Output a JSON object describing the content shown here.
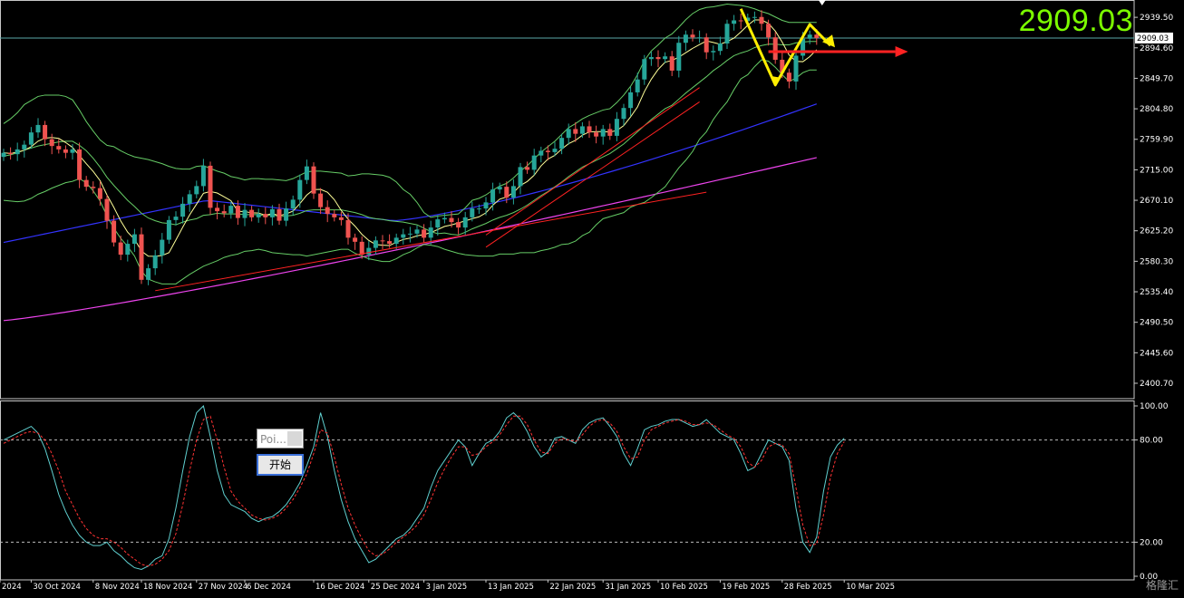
{
  "current_price_display": "2909.03",
  "watermark_text": "格隆汇",
  "widget": {
    "field_text": "Poi...",
    "button_label": "开始"
  },
  "colors": {
    "bull": "#26a69a",
    "bear": "#ef5350",
    "ma_fast": "#ffff99",
    "ma_mid": "#3333ff",
    "ma_slow": "#ee44ee",
    "bollinger": "#66cc66",
    "trend": "#ff2222",
    "pattern": "#ffee00",
    "stoch_main": "#5fd0d0",
    "stoch_signal": "#ff3333",
    "big_price": "#7CFC00"
  },
  "chart_data": [
    {
      "type": "candlestick",
      "title": "",
      "x_labels": [
        "2024",
        "30 Oct 2024",
        "8 Nov 2024",
        "18 Nov 2024",
        "27 Nov 2024",
        "6 Dec 2024",
        "16 Dec 2024",
        "25 Dec 2024",
        "3 Jan 2025",
        "13 Jan 2025",
        "22 Jan 2025",
        "31 Jan 2025",
        "10 Feb 2025",
        "19 Feb 2025",
        "28 Feb 2025",
        "10 Mar 2025"
      ],
      "y_ticks": [
        2939.5,
        2894.6,
        2849.7,
        2804.8,
        2759.9,
        2715.0,
        2670.1,
        2625.2,
        2580.3,
        2535.4,
        2490.5,
        2445.6,
        2400.7
      ],
      "ylim": [
        2378,
        2965
      ],
      "price_line": 2909.03,
      "price_label": "2909.03",
      "close": [
        2740,
        2738,
        2745,
        2752,
        2770,
        2781,
        2760,
        2750,
        2745,
        2740,
        2745,
        2700,
        2690,
        2688,
        2672,
        2640,
        2608,
        2590,
        2606,
        2620,
        2553,
        2570,
        2589,
        2612,
        2641,
        2646,
        2665,
        2679,
        2691,
        2721,
        2659,
        2654,
        2651,
        2662,
        2644,
        2656,
        2645,
        2650,
        2645,
        2657,
        2640,
        2658,
        2671,
        2700,
        2720,
        2680,
        2660,
        2650,
        2645,
        2641,
        2615,
        2609,
        2590,
        2600,
        2611,
        2610,
        2606,
        2615,
        2620,
        2621,
        2627,
        2615,
        2630,
        2642,
        2644,
        2638,
        2630,
        2645,
        2658,
        2658,
        2667,
        2686,
        2690,
        2674,
        2691,
        2719,
        2715,
        2736,
        2743,
        2741,
        2746,
        2762,
        2775,
        2768,
        2779,
        2770,
        2764,
        2775,
        2765,
        2790,
        2806,
        2829,
        2848,
        2878,
        2881,
        2878,
        2882,
        2861,
        2902,
        2914,
        2910,
        2910,
        2888,
        2890,
        2901,
        2930,
        2935,
        2934,
        2939,
        2940,
        2930,
        2910,
        2877,
        2858,
        2845,
        2883,
        2908,
        2914,
        2909
      ],
      "bollinger_upper": [
        2783,
        2790,
        2799,
        2811,
        2817,
        2823,
        2825,
        2825,
        2825,
        2823,
        2818,
        2803,
        2786,
        2772,
        2759,
        2751,
        2749,
        2743,
        2738,
        2734,
        2732,
        2730,
        2727,
        2724,
        2720,
        2717,
        2716,
        2716,
        2720,
        2721,
        2717,
        2713,
        2710,
        2705,
        2703,
        2700,
        2702,
        2702,
        2701,
        2701,
        2700,
        2699,
        2702,
        2707,
        2712,
        2713,
        2713,
        2712,
        2711,
        2710,
        2706,
        2707,
        2709,
        2709,
        2708,
        2707,
        2704,
        2697,
        2686,
        2679,
        2667,
        2652,
        2645,
        2647,
        2648,
        2649,
        2650,
        2659,
        2670,
        2673,
        2678,
        2685,
        2691,
        2695,
        2703,
        2713,
        2721,
        2731,
        2741,
        2749,
        2757,
        2767,
        2777,
        2783,
        2790,
        2795,
        2799,
        2803,
        2805,
        2814,
        2825,
        2838,
        2855,
        2876,
        2890,
        2899,
        2909,
        2915,
        2925,
        2936,
        2945,
        2951,
        2954,
        2955,
        2957,
        2959,
        2958,
        2957,
        2955,
        2952,
        2948,
        2945,
        2940,
        2935,
        2932,
        2932,
        2932,
        2932,
        2932
      ],
      "bollinger_lower": [
        2670,
        2669,
        2668,
        2669,
        2673,
        2679,
        2683,
        2688,
        2692,
        2696,
        2698,
        2702,
        2696,
        2684,
        2669,
        2647,
        2629,
        2614,
        2602,
        2588,
        2566,
        2554,
        2550,
        2547,
        2547,
        2547,
        2554,
        2561,
        2567,
        2573,
        2577,
        2581,
        2586,
        2589,
        2591,
        2595,
        2596,
        2598,
        2596,
        2593,
        2592,
        2591,
        2590,
        2590,
        2588,
        2590,
        2592,
        2594,
        2596,
        2598,
        2598,
        2592,
        2588,
        2584,
        2582,
        2580,
        2580,
        2584,
        2590,
        2594,
        2600,
        2605,
        2604,
        2602,
        2598,
        2595,
        2592,
        2590,
        2589,
        2588,
        2588,
        2588,
        2591,
        2591,
        2591,
        2593,
        2593,
        2593,
        2596,
        2598,
        2601,
        2605,
        2606,
        2610,
        2618,
        2623,
        2634,
        2643,
        2646,
        2649,
        2652,
        2660,
        2664,
        2667,
        2674,
        2682,
        2690,
        2704,
        2718,
        2729,
        2742,
        2760,
        2771,
        2789,
        2803,
        2815,
        2833,
        2849,
        2855,
        2867,
        2877,
        2875,
        2866,
        2855,
        2845,
        2850,
        2858,
        2862,
        2862
      ],
      "bollinger_mid": [
        2735,
        2737,
        2740,
        2744,
        2747,
        2750,
        2752,
        2754,
        2756,
        2757,
        2757,
        2751,
        2743,
        2732,
        2719,
        2704,
        2692,
        2681,
        2670,
        2661,
        2651,
        2644,
        2640,
        2637,
        2636,
        2634,
        2638,
        2641,
        2643,
        2648,
        2649,
        2651,
        2650,
        2650,
        2650,
        2649,
        2649,
        2649,
        2647,
        2649,
        2646,
        2647,
        2648,
        2651,
        2655,
        2656,
        2656,
        2656,
        2656,
        2656,
        2654,
        2652,
        2649,
        2645,
        2643,
        2642,
        2640,
        2639,
        2638,
        2636,
        2634,
        2629,
        2624,
        2621,
        2622,
        2620,
        2619,
        2623,
        2628,
        2632,
        2636,
        2641,
        2645,
        2648,
        2652,
        2657,
        2663,
        2670,
        2677,
        2683,
        2690,
        2697,
        2705,
        2712,
        2719,
        2724,
        2729,
        2734,
        2739,
        2746,
        2753,
        2762,
        2771,
        2780,
        2789,
        2797,
        2805,
        2810,
        2819,
        2828,
        2836,
        2844,
        2852,
        2861,
        2868,
        2876,
        2883,
        2887,
        2890,
        2895,
        2898,
        2900,
        2900,
        2899,
        2899,
        2902,
        2903,
        2904,
        2904
      ],
      "ma_slow_line": {
        "start": 2493,
        "end": 2733,
        "label": ""
      },
      "ma_mid_line": {
        "start": 2608,
        "end": 2812,
        "label": ""
      },
      "annotations": {
        "trend_lower": [
          [
            22,
            2537
          ],
          [
            102,
            2682
          ]
        ],
        "trend_channel_upper": [
          [
            70,
            2619
          ],
          [
            101,
            2836
          ]
        ],
        "trend_channel_lower": [
          [
            70,
            2601
          ],
          [
            101,
            2815
          ]
        ],
        "pattern_zigzag": [
          [
            107,
            2952
          ],
          [
            112,
            2840
          ],
          [
            117,
            2929
          ],
          [
            120,
            2898
          ]
        ],
        "target_arrow": [
          [
            111,
            2889
          ],
          [
            131,
            2889
          ]
        ]
      }
    },
    {
      "type": "line",
      "title": "",
      "ylim": [
        0,
        100
      ],
      "y_ticks": [
        100.0,
        80.0,
        20.0,
        0.0
      ],
      "levels": [
        80,
        20
      ],
      "series": [
        {
          "values": [
            80,
            82,
            84,
            86,
            88,
            84,
            75,
            62,
            48,
            38,
            30,
            24,
            20,
            18,
            18,
            20,
            15,
            12,
            8,
            5,
            4,
            6,
            10,
            12,
            22,
            40,
            62,
            82,
            96,
            100,
            82,
            62,
            48,
            42,
            40,
            38,
            34,
            32,
            34,
            35,
            38,
            42,
            48,
            55,
            65,
            76,
            96,
            82,
            62,
            45,
            32,
            22,
            15,
            8,
            10,
            14,
            18,
            22,
            24,
            28,
            34,
            40,
            52,
            62,
            68,
            74,
            80,
            76,
            65,
            72,
            78,
            80,
            85,
            93,
            96,
            92,
            85,
            76,
            70,
            73,
            81,
            82,
            80,
            78,
            86,
            90,
            92,
            93,
            88,
            82,
            72,
            65,
            75,
            86,
            88,
            89,
            91,
            92,
            92,
            90,
            88,
            89,
            92,
            88,
            84,
            82,
            80,
            72,
            62,
            64,
            72,
            80,
            78,
            76,
            68,
            40,
            20,
            14,
            23,
            50,
            70,
            77,
            81
          ]
        },
        {
          "values": [
            78,
            80,
            82,
            84,
            85,
            84,
            80,
            72,
            62,
            50,
            42,
            34,
            28,
            24,
            22,
            22,
            20,
            17,
            13,
            10,
            7,
            6,
            7,
            10,
            15,
            25,
            42,
            62,
            80,
            92,
            94,
            80,
            64,
            50,
            44,
            40,
            36,
            34,
            33,
            34,
            36,
            40,
            45,
            52,
            60,
            72,
            86,
            84,
            70,
            54,
            40,
            30,
            22,
            15,
            12,
            13,
            16,
            20,
            23,
            26,
            30,
            36,
            45,
            55,
            63,
            70,
            76,
            76,
            71,
            72,
            76,
            79,
            83,
            89,
            94,
            94,
            89,
            80,
            73,
            72,
            78,
            81,
            80,
            79,
            83,
            88,
            91,
            92,
            90,
            85,
            76,
            69,
            70,
            80,
            86,
            88,
            90,
            91,
            92,
            91,
            89,
            89,
            90,
            89,
            86,
            83,
            81,
            76,
            67,
            64,
            68,
            76,
            78,
            77,
            72,
            52,
            30,
            18,
            19,
            36,
            58,
            72,
            79
          ]
        }
      ]
    }
  ]
}
